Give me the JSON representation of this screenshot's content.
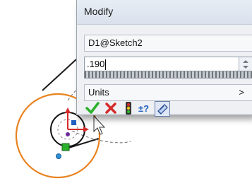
{
  "dialog": {
    "title": "Modify",
    "dimension_name": "D1@Sketch2",
    "value": ".190",
    "units_label": "Units",
    "units_arrow": ">"
  },
  "toolbar": {
    "buttons": [
      {
        "name": "ok-check-icon",
        "symbol": "✓"
      },
      {
        "name": "cancel-x-icon",
        "symbol": "✕"
      },
      {
        "name": "rebuild-traffic-light-icon",
        "symbol": ""
      },
      {
        "name": "reset-spin-increment-icon",
        "symbol": "±?"
      },
      {
        "name": "mark-dimension-icon",
        "symbol": ""
      }
    ]
  },
  "colors": {
    "circle_orange": "#e8821e",
    "ok_green": "#2bb02b",
    "cancel_red": "#d42a2a",
    "accent_blue": "#2060c0"
  }
}
